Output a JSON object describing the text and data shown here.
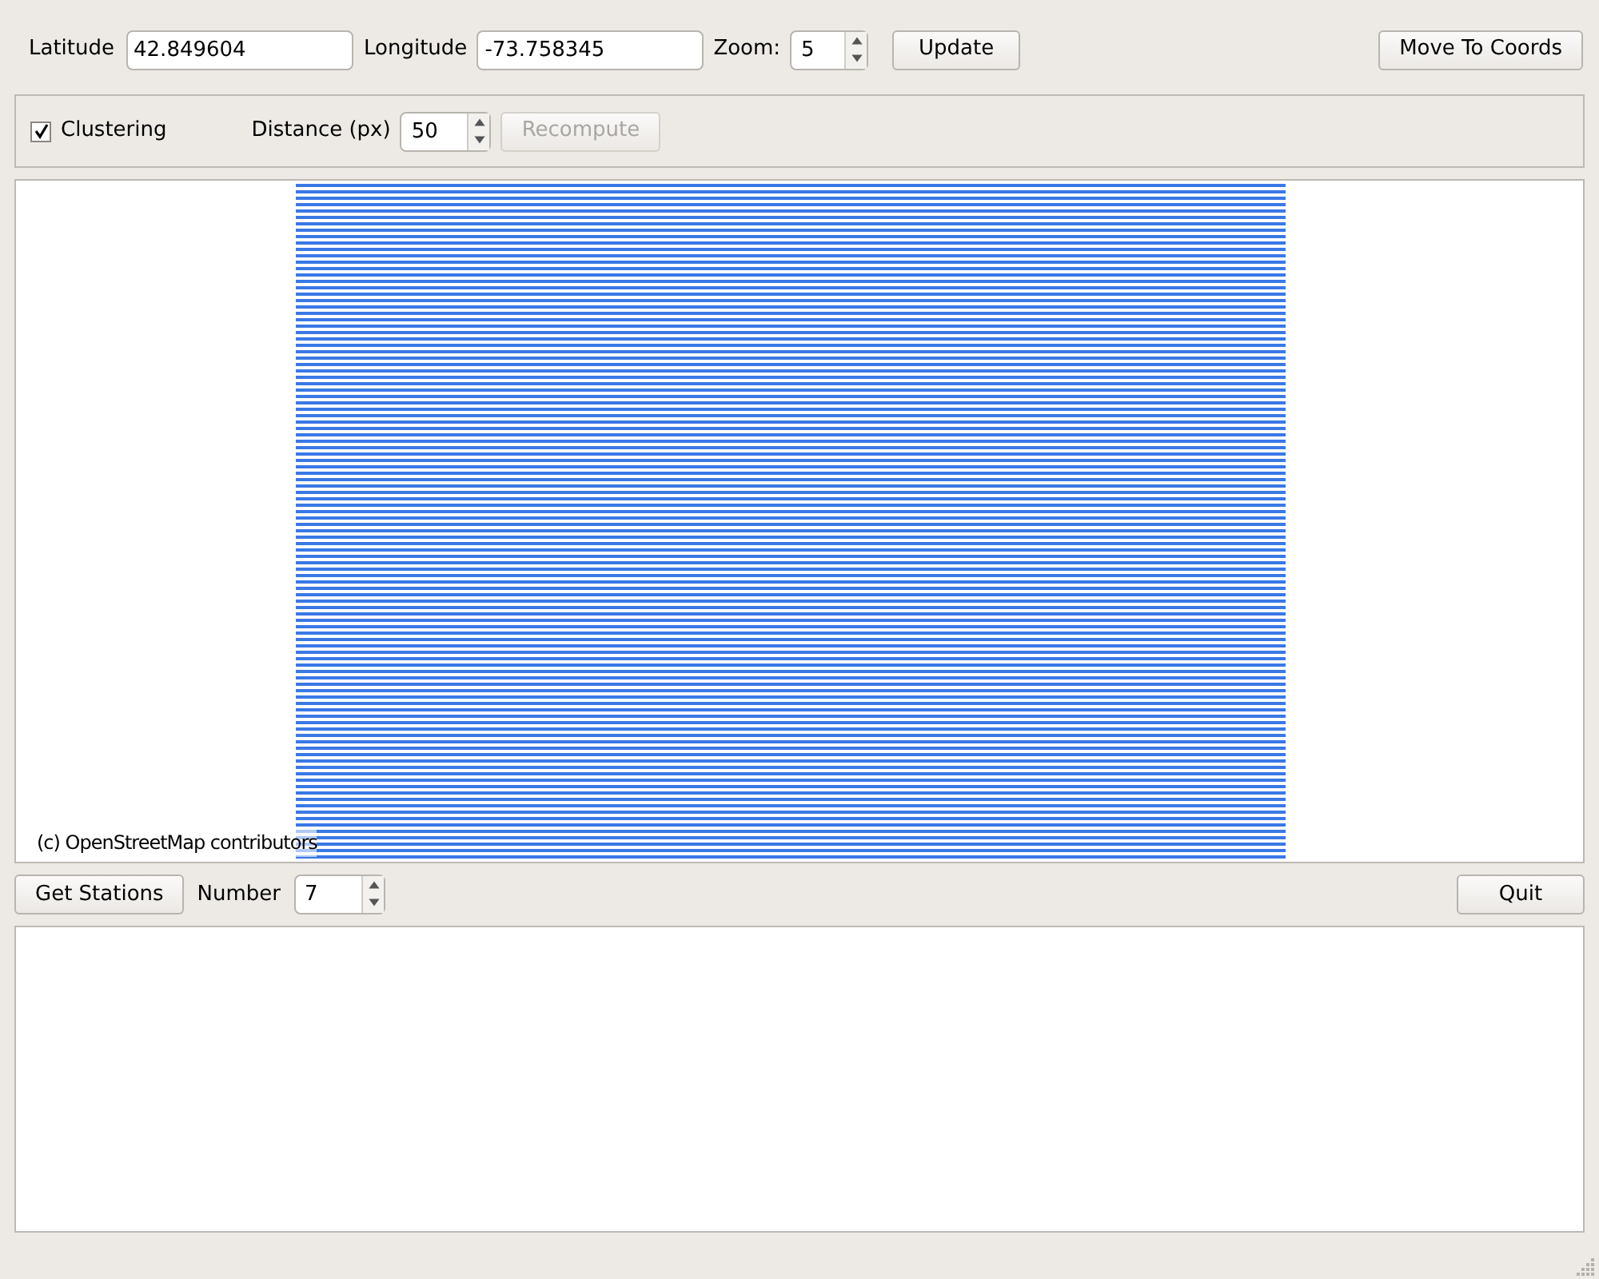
{
  "coords": {
    "latitude_label": "Latitude",
    "latitude": "42.849604",
    "longitude_label": "Longitude",
    "longitude": "-73.758345",
    "zoom_label": "Zoom:",
    "zoom": "5",
    "update_button": "Update",
    "move_button": "Move To Coords"
  },
  "clustering": {
    "label": "Clustering",
    "checked": true,
    "distance_label": "Distance (px)",
    "distance": "50",
    "recompute_button": "Recompute",
    "recompute_disabled": true
  },
  "map": {
    "attribution": "(c) OpenStreetMap contributors"
  },
  "stations": {
    "get_button": "Get Stations",
    "number_label": "Number",
    "number": "7",
    "quit_button": "Quit"
  }
}
